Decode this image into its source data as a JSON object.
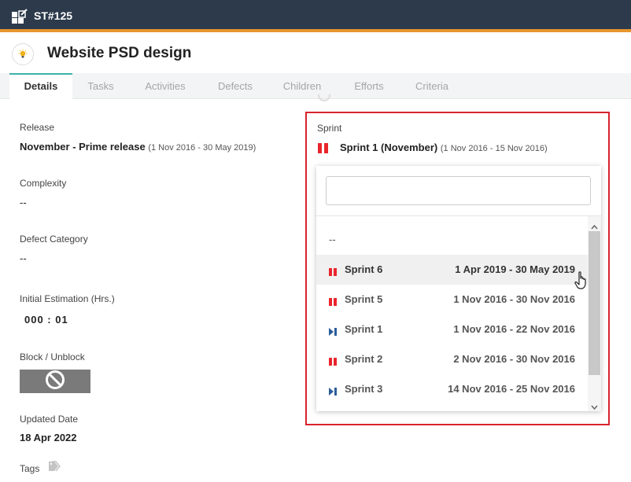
{
  "topbar": {
    "title": "ST#125"
  },
  "header": {
    "title": "Website PSD design"
  },
  "tabs": [
    {
      "label": "Details"
    },
    {
      "label": "Tasks"
    },
    {
      "label": "Activities"
    },
    {
      "label": "Defects"
    },
    {
      "label": "Children"
    },
    {
      "label": "Efforts"
    },
    {
      "label": "Criteria"
    }
  ],
  "fields": {
    "release": {
      "label": "Release",
      "value": "November - Prime release",
      "range": "(1 Nov 2016 - 30 May 2019)"
    },
    "complexity": {
      "label": "Complexity",
      "value": "--"
    },
    "defect_category": {
      "label": "Defect Category",
      "value": "--"
    },
    "initial_estimation": {
      "label": "Initial Estimation (Hrs.)",
      "value": "000 : 01"
    },
    "block_unblock": {
      "label": "Block / Unblock"
    },
    "updated_date": {
      "label": "Updated Date",
      "value": "18 Apr 2022"
    },
    "tags": {
      "label": "Tags"
    }
  },
  "sprint": {
    "label": "Sprint",
    "selected_name": "Sprint 1 (November)",
    "selected_range": "(1 Nov 2016 - 15 Nov 2016)",
    "search_placeholder": "",
    "empty_option": "--",
    "options": [
      {
        "name": "Sprint 6",
        "range": "1 Apr 2019 - 30 May 2019",
        "icon": "pause-icon"
      },
      {
        "name": "Sprint 5",
        "range": "1 Nov 2016 - 30 Nov 2016",
        "icon": "pause-icon"
      },
      {
        "name": "Sprint 1",
        "range": "1 Nov 2016 - 22 Nov 2016",
        "icon": "skip-icon"
      },
      {
        "name": "Sprint 2",
        "range": "2 Nov 2016 - 30 Nov 2016",
        "icon": "pause-icon"
      },
      {
        "name": "Sprint 3",
        "range": "14 Nov 2016 - 25 Nov 2016",
        "icon": "skip-icon"
      }
    ]
  },
  "colors": {
    "topbar_bg": "#2c3a4b",
    "topbar_accent": "#e8962e",
    "active_tab_accent": "#3bb3a5",
    "highlight_border": "#d9232d",
    "pause_icon": "#e8262c",
    "skip_icon": "#2b5c9a"
  }
}
